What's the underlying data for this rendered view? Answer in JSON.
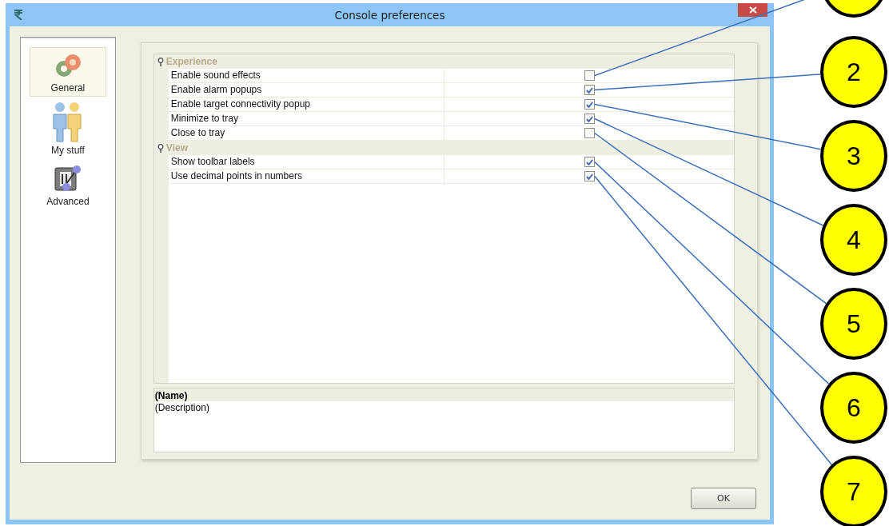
{
  "window": {
    "title": "Console preferences"
  },
  "sidebar": {
    "items": [
      {
        "label": "General",
        "kind": "gears",
        "selected": true
      },
      {
        "label": "My stuff",
        "kind": "people",
        "selected": false
      },
      {
        "label": "Advanced",
        "kind": "switch",
        "selected": false
      }
    ]
  },
  "property_grid": {
    "categories": [
      {
        "name": "Experience",
        "expanded": true,
        "rows": [
          {
            "label": "Enable sound effects",
            "checked": false
          },
          {
            "label": "Enable alarm popups",
            "checked": true
          },
          {
            "label": "Enable target connectivity popup",
            "checked": true
          },
          {
            "label": "Minimize to tray",
            "checked": true
          },
          {
            "label": "Close to tray",
            "checked": false
          }
        ]
      },
      {
        "name": "View",
        "expanded": true,
        "rows": [
          {
            "label": "Show toolbar labels",
            "checked": true
          },
          {
            "label": "Use decimal points in numbers",
            "checked": true
          }
        ]
      }
    ]
  },
  "description": {
    "name": "(Name)",
    "text": "(Description)"
  },
  "buttons": [
    {
      "label": "OK"
    }
  ],
  "callouts": [
    {
      "kind": "cut"
    },
    {
      "kind": "full",
      "label": "2"
    },
    {
      "kind": "full",
      "label": "3"
    },
    {
      "kind": "full",
      "label": "4"
    },
    {
      "kind": "full",
      "label": "5"
    },
    {
      "kind": "full",
      "label": "6"
    },
    {
      "kind": "full",
      "label": "7"
    }
  ]
}
